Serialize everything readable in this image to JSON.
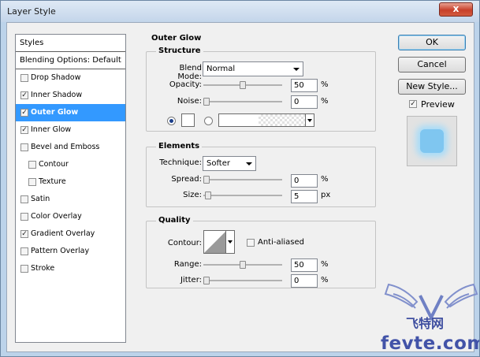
{
  "window": {
    "title": "Layer Style",
    "close_label": "x"
  },
  "styles_panel": {
    "header": "Styles",
    "blending_options": "Blending Options: Default",
    "items": [
      {
        "label": "Drop Shadow",
        "checked": false,
        "sub": false,
        "selected": false
      },
      {
        "label": "Inner Shadow",
        "checked": true,
        "sub": false,
        "selected": false
      },
      {
        "label": "Outer Glow",
        "checked": true,
        "sub": false,
        "selected": true
      },
      {
        "label": "Inner Glow",
        "checked": true,
        "sub": false,
        "selected": false
      },
      {
        "label": "Bevel and Emboss",
        "checked": false,
        "sub": false,
        "selected": false
      },
      {
        "label": "Contour",
        "checked": false,
        "sub": true,
        "selected": false
      },
      {
        "label": "Texture",
        "checked": false,
        "sub": true,
        "selected": false
      },
      {
        "label": "Satin",
        "checked": false,
        "sub": false,
        "selected": false
      },
      {
        "label": "Color Overlay",
        "checked": false,
        "sub": false,
        "selected": false
      },
      {
        "label": "Gradient Overlay",
        "checked": true,
        "sub": false,
        "selected": false
      },
      {
        "label": "Pattern Overlay",
        "checked": false,
        "sub": false,
        "selected": false
      },
      {
        "label": "Stroke",
        "checked": false,
        "sub": false,
        "selected": false
      }
    ]
  },
  "outer_glow": {
    "title": "Outer Glow",
    "structure": {
      "label": "Structure",
      "blend_mode_label": "Blend Mode:",
      "blend_mode_value": "Normal",
      "opacity_label": "Opacity:",
      "opacity_value": "50",
      "opacity_unit": "%",
      "noise_label": "Noise:",
      "noise_value": "0",
      "noise_unit": "%",
      "glow_color": "#ffffff",
      "color_mode_selected": "solid"
    },
    "elements": {
      "label": "Elements",
      "technique_label": "Technique:",
      "technique_value": "Softer",
      "spread_label": "Spread:",
      "spread_value": "0",
      "spread_unit": "%",
      "size_label": "Size:",
      "size_value": "5",
      "size_unit": "px"
    },
    "quality": {
      "label": "Quality",
      "contour_label": "Contour:",
      "anti_aliased_label": "Anti-aliased",
      "anti_aliased_checked": false,
      "range_label": "Range:",
      "range_value": "50",
      "range_unit": "%",
      "jitter_label": "Jitter:",
      "jitter_value": "0",
      "jitter_unit": "%"
    }
  },
  "buttons": {
    "ok": "OK",
    "cancel": "Cancel",
    "new_style": "New Style..."
  },
  "preview": {
    "label": "Preview",
    "checked": true,
    "glow_color": "#7fc6f0"
  },
  "watermark": {
    "logo_text": "飞特网",
    "domain": "fevte.com"
  }
}
